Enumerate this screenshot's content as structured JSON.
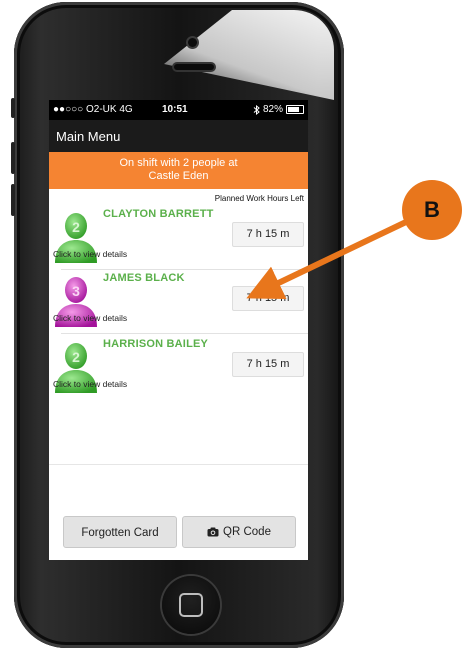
{
  "status_bar": {
    "carrier": "●●○○○ O2-UK  4G",
    "time": "10:51",
    "bluetooth_icon": "bluetooth-icon",
    "battery": "82%",
    "battery_level": 0.82
  },
  "nav": {
    "title": "Main Menu"
  },
  "banner": {
    "line1": "On shift with 2 people at",
    "line2": "Castle Eden"
  },
  "list_header": "Planned Work Hours Left",
  "people": [
    {
      "name": "CLAYTON BARRETT",
      "badge_number": "2",
      "hours": "7 h 15 m",
      "details": "Click to view details",
      "avatar_color": "#47b83c"
    },
    {
      "name": "JAMES BLACK",
      "badge_number": "3",
      "hours": "7 h 15 m",
      "details": "Click to view details",
      "avatar_color": "#c21cb4"
    },
    {
      "name": "HARRISON BAILEY",
      "badge_number": "2",
      "hours": "7 h 15 m",
      "details": "Click to view details",
      "avatar_color": "#47b83c"
    }
  ],
  "buttons": {
    "forgotten_card": "Forgotten Card",
    "qr_code": "QR Code",
    "qr_icon": "camera-icon"
  },
  "annotation": {
    "label": "B",
    "color": "#e8761c"
  },
  "colors": {
    "accent": "#f58432",
    "name_green": "#5bb04b"
  }
}
